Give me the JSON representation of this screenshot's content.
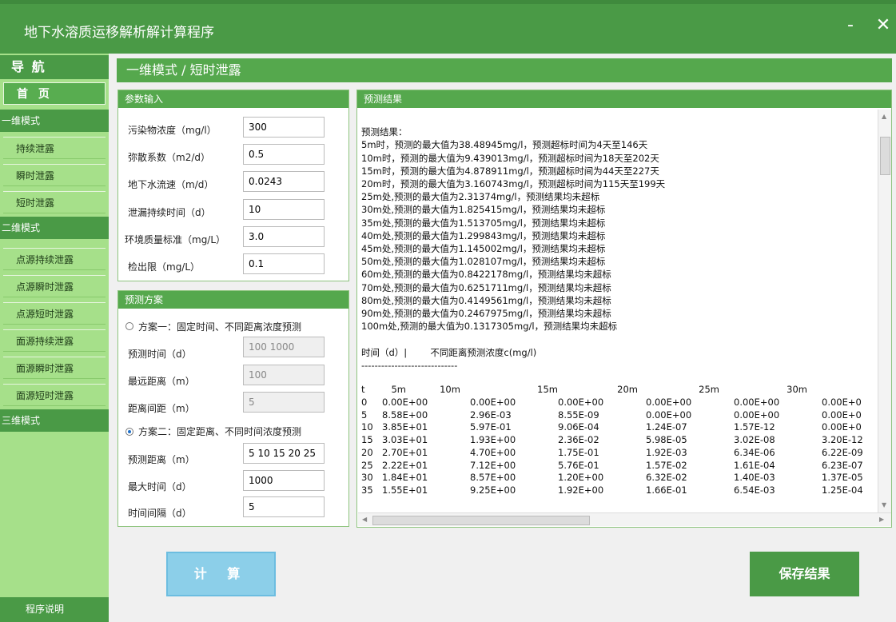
{
  "window": {
    "title": "地下水溶质运移解析解计算程序",
    "minimize": "-",
    "close": "✕"
  },
  "sidebar": {
    "title": "导 航",
    "home": "首 页",
    "sections": [
      {
        "label": "一维模式",
        "items": [
          "持续泄露",
          "瞬时泄露",
          "短时泄露"
        ]
      },
      {
        "label": "二维模式",
        "items": [
          "点源持续泄露",
          "点源瞬时泄露",
          "点源短时泄露",
          "面源持续泄露",
          "面源瞬时泄露",
          "面源短时泄露"
        ]
      },
      {
        "label": "三维模式",
        "items": []
      }
    ],
    "footer": "程序说明"
  },
  "header": {
    "mode": "一维模式 / 短时泄露"
  },
  "params": {
    "title": "参数输入",
    "rows": [
      {
        "label": "污染物浓度（mg/l）",
        "value": "300"
      },
      {
        "label": "弥散系数（m2/d）",
        "value": "0.5"
      },
      {
        "label": "地下水流速（m/d）",
        "value": "0.0243"
      },
      {
        "label": "泄漏持续时间（d）",
        "value": "10"
      },
      {
        "label": "环境质量标准（mg/L）",
        "value": "3.0"
      },
      {
        "label": "检出限（mg/L）",
        "value": "0.1"
      }
    ]
  },
  "scheme": {
    "title": "预测方案",
    "option1": {
      "label": "方案一：固定时间、不同距离浓度预测",
      "rows": [
        {
          "label": "预测时间（d）",
          "value": "100 1000"
        },
        {
          "label": "最远距离（m）",
          "value": "100"
        },
        {
          "label": "距离间距（m）",
          "value": "5"
        }
      ]
    },
    "option2": {
      "label": "方案二：固定距离、不同时间浓度预测",
      "rows": [
        {
          "label": "预测距离（m）",
          "value": "5 10 15 20 25"
        },
        {
          "label": "最大时间（d）",
          "value": "1000"
        },
        {
          "label": "时间间隔（d）",
          "value": "5"
        }
      ]
    }
  },
  "results": {
    "title": "预测结果",
    "heading": "预测结果：",
    "lines": [
      "5m时，预测的最大值为38.48945mg/l，预测超标时间为4天至146天",
      "10m时，预测的最大值为9.439013mg/l，预测超标时间为18天至202天",
      "15m时，预测的最大值为4.878911mg/l，预测超标时间为44天至227天",
      "20m时，预测的最大值为3.160743mg/l，预测超标时间为115天至199天",
      "25m处,预测的最大值为2.31374mg/l，预测结果均未超标",
      "30m处,预测的最大值为1.825415mg/l，预测结果均未超标",
      "35m处,预测的最大值为1.513705mg/l，预测结果均未超标",
      "40m处,预测的最大值为1.299843mg/l，预测结果均未超标",
      "45m处,预测的最大值为1.145002mg/l，预测结果均未超标",
      "50m处,预测的最大值为1.028107mg/l，预测结果均未超标",
      "60m处,预测的最大值为0.8422178mg/l，预测结果均未超标",
      "70m处,预测的最大值为0.6251711mg/l，预测结果均未超标",
      "80m处,预测的最大值为0.4149561mg/l，预测结果均未超标",
      "90m处,预测的最大值为0.2467975mg/l，预测结果均未超标",
      "100m处,预测的最大值为0.1317305mg/l，预测结果均未超标"
    ],
    "table_caption": "时间（d）|        不同距离预测浓度c(mg/l)",
    "separator": "-----------------------------",
    "columns": [
      "t",
      "5m",
      "10m",
      "15m",
      "20m",
      "25m",
      "30m"
    ],
    "rows": [
      [
        "0",
        "0.00E+00",
        "0.00E+00",
        "0.00E+00",
        "0.00E+00",
        "0.00E+00",
        "0.00E+0"
      ],
      [
        "5",
        "8.58E+00",
        "2.96E-03",
        "8.55E-09",
        "0.00E+00",
        "0.00E+00",
        "0.00E+0"
      ],
      [
        "10",
        "3.85E+01",
        "5.97E-01",
        "9.06E-04",
        "1.24E-07",
        "1.57E-12",
        "0.00E+0"
      ],
      [
        "15",
        "3.03E+01",
        "1.93E+00",
        "2.36E-02",
        "5.98E-05",
        "3.02E-08",
        "3.20E-12"
      ],
      [
        "20",
        "2.70E+01",
        "4.70E+00",
        "1.75E-01",
        "1.92E-03",
        "6.34E-06",
        "6.22E-09"
      ],
      [
        "25",
        "2.22E+01",
        "7.12E+00",
        "5.76E-01",
        "1.57E-02",
        "1.61E-04",
        "6.23E-07"
      ],
      [
        "30",
        "1.84E+01",
        "8.57E+00",
        "1.20E+00",
        "6.32E-02",
        "1.40E-03",
        "1.37E-05"
      ],
      [
        "35",
        "1.55E+01",
        "9.25E+00",
        "1.92E+00",
        "1.66E-01",
        "6.54E-03",
        "1.25E-04"
      ]
    ]
  },
  "buttons": {
    "calc": "计 算",
    "save": "保存结果"
  }
}
